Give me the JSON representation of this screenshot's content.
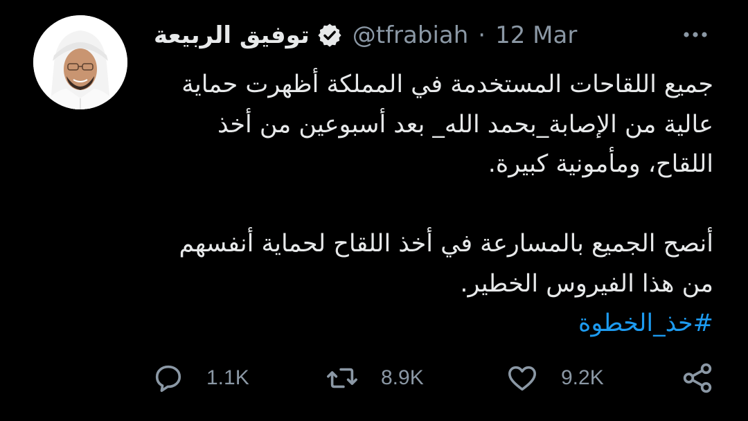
{
  "user": {
    "display_name": "توفيق الربيعة",
    "handle": "@tfrabiah",
    "separator": "·",
    "date": "12 Mar",
    "verified": true
  },
  "tweet": {
    "paragraph_1": "جميع اللقاحات المستخدمة في المملكة أظهرت حماية\nعالية من الإصابة_بحمد الله_ بعد أسبوعين من أخذ\nاللقاح، ومأمونية كبيرة.",
    "paragraph_2": "أنصح الجميع بالمسارعة في أخذ اللقاح لحماية أنفسهم\nمن هذا الفيروس الخطير.",
    "hashtag": "#خذ_الخطوة"
  },
  "actions": {
    "reply_count": "1.1K",
    "retweet_count": "8.9K",
    "like_count": "9.2K"
  },
  "icons": {
    "verified": "verified-badge-icon",
    "more": "more-options-icon",
    "reply": "reply-icon",
    "retweet": "retweet-icon",
    "like": "heart-icon",
    "share": "share-icon"
  },
  "colors": {
    "background": "#000000",
    "text_primary": "#e7e9ea",
    "text_secondary": "#8b98a5",
    "link": "#1d9bf0"
  }
}
